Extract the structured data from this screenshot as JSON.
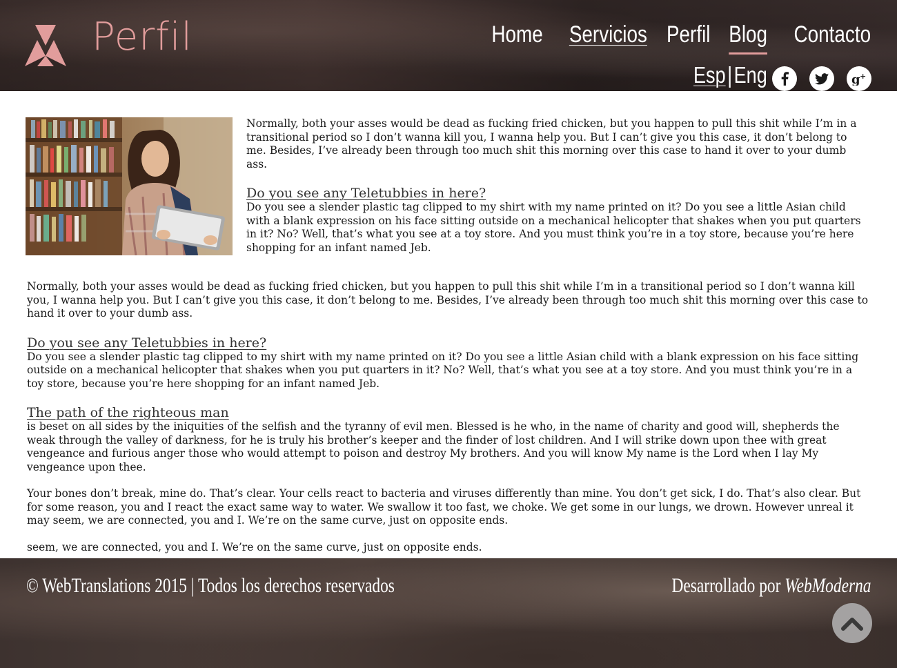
{
  "header": {
    "logo_text": "Perfil",
    "nav": [
      {
        "label": "Home"
      },
      {
        "label": "Servicios"
      },
      {
        "label": "Perfil"
      },
      {
        "label": "Blog"
      },
      {
        "label": "Contacto"
      }
    ],
    "lang": {
      "esp": "Esp",
      "sep": "|",
      "eng": "Eng"
    },
    "social": [
      "facebook-icon",
      "twitter-icon",
      "google-plus-icon"
    ]
  },
  "article": {
    "intro_p1": "Normally, both your asses would be dead as fucking fried chicken, but you happen to pull this shit while I’m in a transitional period so I don’t wanna kill you, I wanna help you. But I can’t give you this case, it don’t belong to me. Besides, I’ve already been through too much shit this morning over this case to hand it over to your dumb ass.",
    "intro_h": "Do you see any Teletubbies in here?",
    "intro_p2": "Do you see a slender plastic tag clipped to my shirt with my name printed on it? Do you see a little Asian child with a blank expression on his face sitting outside on a mechanical helicopter that shakes when you put quarters in it? No? Well, that’s what you see at a toy store. And you must think you’re in a toy store, because you’re here shopping for an infant named Jeb.",
    "p3": "Normally, both your asses would be dead as fucking fried chicken, but you happen to pull this shit while I’m in a transitional period so I don’t wanna kill you, I wanna help you. But I can’t give you this case, it don’t belong to me. Besides, I’ve already been through too much shit this morning over this case to hand it over to your dumb ass.",
    "h2": "Do you see any Teletubbies in here?",
    "p4": "Do you see a slender plastic tag clipped to my shirt with my name printed on it? Do you see a little Asian child with a blank expression on his face sitting outside on a mechanical helicopter that shakes when you put quarters in it? No? Well, that’s what you see at a toy store. And you must think you’re in a toy store, because you’re here shopping for an infant named Jeb.",
    "h3": "The path of the righteous man",
    "p5": "is beset on all sides by the iniquities of the selfish and the tyranny of evil men. Blessed is he who, in the name of charity and good will, shepherds the weak through the valley of darkness, for he is truly his brother’s keeper and the finder of lost children. And I will strike down upon thee with great vengeance and furious anger those who would attempt to poison and destroy My brothers. And you will know My name is the Lord when I lay My vengeance upon thee.",
    "p6": "Your bones don’t break, mine do. That’s clear. Your cells react to bacteria and viruses differently than mine. You don’t get sick, I do. That’s also clear. But for some reason, you and I react the exact same way to water. We swallow it too fast, we choke. We get some in our lungs, we drown. However unreal it may seem, we are connected, you and I. We’re on the same curve, just on opposite ends.",
    "p7": "seem, we are connected, you and I. We’re on the same curve, just on opposite ends."
  },
  "footer": {
    "copyright": "© WebTranslations 2015 | Todos los derechos reservados",
    "developed_prefix": "Desarrollado por ",
    "developed_brand": "WebModerna",
    "back_to_top_icon": "chevron-up-icon"
  },
  "colors": {
    "accent": "#e29d9c",
    "text": "#1a1a1a"
  }
}
